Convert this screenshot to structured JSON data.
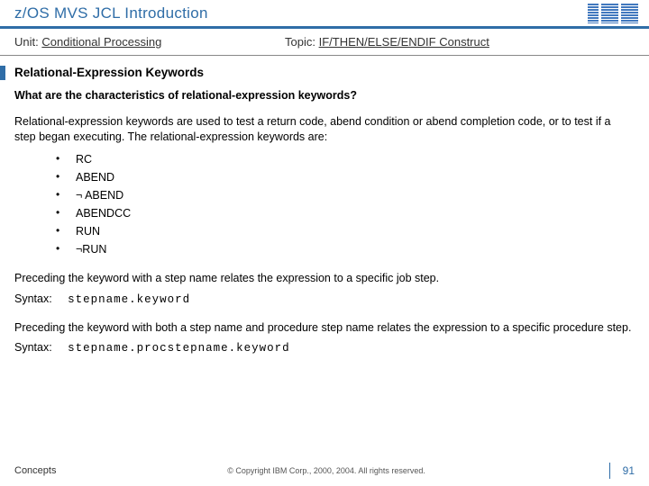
{
  "title": "z/OS MVS JCL Introduction",
  "meta": {
    "unit_label": "Unit:",
    "unit_value": "Conditional Processing",
    "topic_label": "Topic:",
    "topic_value": "IF/THEN/ELSE/ENDIF Construct"
  },
  "section_heading": "Relational-Expression Keywords",
  "question": "What are the characteristics of relational-expression keywords?",
  "intro": "Relational-expression keywords are used to test a return code, abend condition or abend completion code, or to test if a step began executing. The relational-expression keywords are:",
  "keywords": [
    "RC",
    "ABEND",
    "¬ ABEND",
    "ABENDCC",
    "RUN",
    "¬RUN"
  ],
  "block1": {
    "text": "Preceding the keyword with a step name relates the expression to a specific job step.",
    "syntax_label": "Syntax:",
    "syntax_code": "stepname.keyword"
  },
  "block2": {
    "text": "Preceding the keyword with both a step name and procedure step name relates the expression to a specific procedure step.",
    "syntax_label": "Syntax:",
    "syntax_code": "stepname.procstepname.keyword"
  },
  "footer": {
    "left": "Concepts",
    "center": "© Copyright IBM Corp., 2000, 2004. All rights reserved.",
    "right": "91"
  }
}
